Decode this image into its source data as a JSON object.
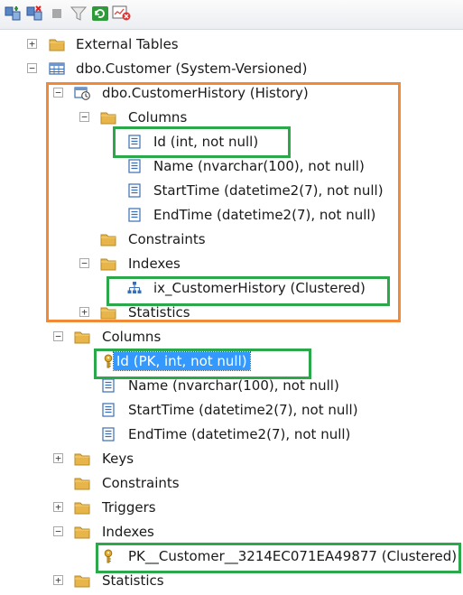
{
  "toolbar": {
    "buttons": [
      {
        "name": "connect-object-explorer-icon"
      },
      {
        "name": "disconnect-icon"
      },
      {
        "name": "stop-icon"
      },
      {
        "name": "filter-icon"
      },
      {
        "name": "refresh-icon"
      },
      {
        "name": "activity-monitor-icon"
      }
    ]
  },
  "tree": {
    "external_tables": "External Tables",
    "customer": "dbo.Customer (System-Versioned)",
    "history": "dbo.CustomerHistory (History)",
    "history_columns": "Columns",
    "history_col_id": "Id (int, not null)",
    "history_col_name": "Name (nvarchar(100), not null)",
    "history_col_start": "StartTime (datetime2(7), not null)",
    "history_col_end": "EndTime (datetime2(7), not null)",
    "history_constraints": "Constraints",
    "history_indexes": "Indexes",
    "history_index": "ix_CustomerHistory (Clustered)",
    "history_statistics": "Statistics",
    "columns": "Columns",
    "col_id": "Id (PK, int, not null)",
    "col_name": "Name (nvarchar(100), not null)",
    "col_start": "StartTime (datetime2(7), not null)",
    "col_end": "EndTime (datetime2(7), not null)",
    "keys": "Keys",
    "constraints": "Constraints",
    "triggers": "Triggers",
    "indexes": "Indexes",
    "pk_index": "PK__Customer__3214EC071EA49877 (Clustered)",
    "statistics": "Statistics",
    "expander": {
      "collapsed": "+",
      "expanded": "−"
    }
  },
  "colors": {
    "highlight_orange": "#f08a37",
    "highlight_green": "#2aa84a",
    "selection": "#3399ff",
    "folder": "#e8b54a"
  }
}
